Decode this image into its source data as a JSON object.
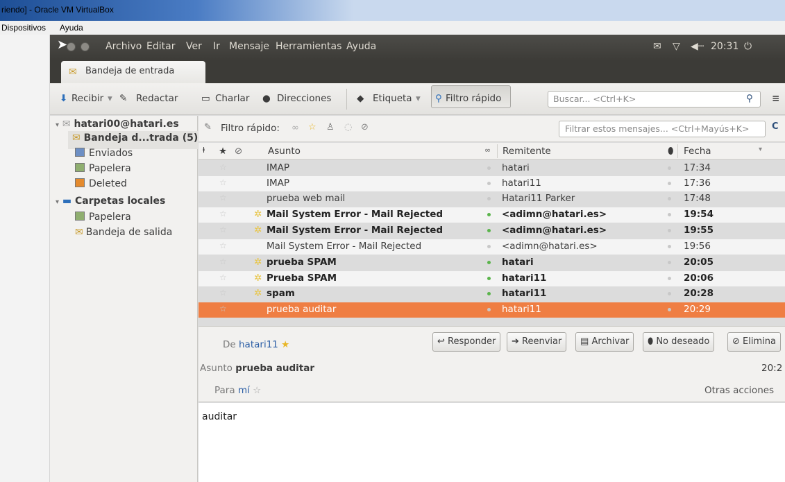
{
  "host": {
    "title": "riendo] - Oracle VM VirtualBox",
    "menu": [
      "Dispositivos",
      "Ayuda"
    ]
  },
  "ubuntu_bar": {
    "menu": [
      "Archivo",
      "Editar",
      "Ver",
      "Ir",
      "Mensaje",
      "Herramientas",
      "Ayuda"
    ],
    "clock": "20:31"
  },
  "tab": {
    "label": "Bandeja de entrada"
  },
  "toolbar": {
    "recibir": "Recibir",
    "redactar": "Redactar",
    "charlar": "Charlar",
    "direcciones": "Direcciones",
    "etiqueta": "Etiqueta",
    "filtro_rapido": "Filtro rápido",
    "search_placeholder": "Buscar... <Ctrl+K>"
  },
  "folders": {
    "account": "hatari00@hatari.es",
    "items": [
      {
        "label": "Bandeja d...trada (5)"
      },
      {
        "label": "Enviados"
      },
      {
        "label": "Papelera"
      },
      {
        "label": "Deleted"
      }
    ],
    "local": "Carpetas locales",
    "local_items": [
      {
        "label": "Papelera"
      },
      {
        "label": "Bandeja de salida"
      }
    ]
  },
  "filterbar": {
    "label": "Filtro rápido:",
    "placeholder": "Filtrar estos mensajes... <Ctrl+Mayús+K>"
  },
  "columns": {
    "asunto": "Asunto",
    "remitente": "Remitente",
    "fecha": "Fecha"
  },
  "messages": [
    {
      "subject": "IMAP",
      "from": "hatari",
      "date": "17:34",
      "bold": false
    },
    {
      "subject": "IMAP",
      "from": "hatari11",
      "date": "17:36",
      "bold": false
    },
    {
      "subject": "prueba web mail",
      "from": "Hatari11 Parker",
      "date": "17:48",
      "bold": false
    },
    {
      "subject": "Mail System Error - Mail Rejected",
      "from": "<adimn@hatari.es>",
      "date": "19:54",
      "bold": true
    },
    {
      "subject": "Mail System Error - Mail Rejected",
      "from": "<adimn@hatari.es>",
      "date": "19:55",
      "bold": true
    },
    {
      "subject": "Mail System Error - Mail Rejected",
      "from": "<adimn@hatari.es>",
      "date": "19:56",
      "bold": false
    },
    {
      "subject": "prueba SPAM",
      "from": "hatari",
      "date": "20:05",
      "bold": true
    },
    {
      "subject": "Prueba SPAM",
      "from": "hatari11",
      "date": "20:06",
      "bold": true
    },
    {
      "subject": "spam",
      "from": "hatari11",
      "date": "20:28",
      "bold": true
    },
    {
      "subject": "prueba auditar",
      "from": "hatari11",
      "date": "20:29",
      "bold": false,
      "selected": true
    }
  ],
  "message_header": {
    "de_label": "De",
    "de_value": "hatari11",
    "asunto_label": "Asunto",
    "asunto_value": "prueba auditar",
    "para_label": "Para",
    "para_value": "mí",
    "time": "20:2",
    "otras_acciones": "Otras acciones",
    "buttons": [
      "Responder",
      "Reenviar",
      "Archivar",
      "No deseado",
      "Elimina"
    ]
  },
  "message_body": "auditar"
}
